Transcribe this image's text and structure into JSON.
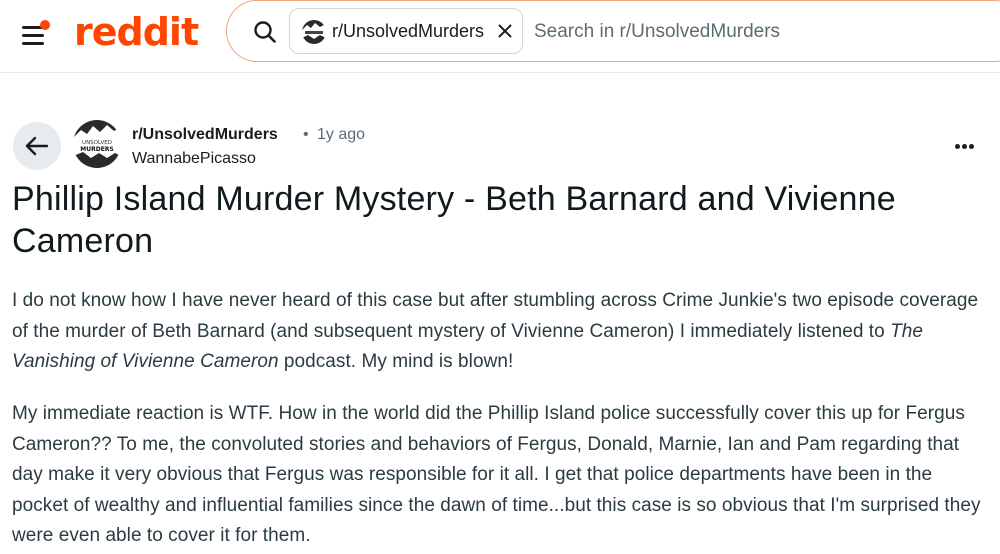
{
  "header": {
    "logo_text": "reddit",
    "brand_color": "#ff4500",
    "search": {
      "chip_label": "r/UnsolvedMurders",
      "placeholder": "Search in r/UnsolvedMurders",
      "value": ""
    }
  },
  "post": {
    "subreddit": "r/UnsolvedMurders",
    "subreddit_avatar_text": [
      "UNSOLVED",
      "MURDERS"
    ],
    "separator": "•",
    "time_ago": "1y ago",
    "author": "WannabePicasso",
    "title": "Phillip Island Murder Mystery - Beth Barnard and Vivienne Cameron",
    "body": {
      "p1_before": "I do not know how I have never heard of this case but after stumbling across Crime Junkie's two episode coverage of the murder of Beth Barnard (and subsequent mystery of Vivienne Cameron) I immediately listened to ",
      "p1_italic": "The Vanishing of Vivienne Cameron",
      "p1_after": " podcast. My mind is blown!",
      "p2": "My immediate reaction is WTF. How in the world did the Phillip Island police successfully cover this up for Fergus Cameron?? To me, the convoluted stories and behaviors of Fergus, Donald, Marnie, Ian and Pam regarding that day make it very obvious that Fergus was responsible for it all. I get that police departments have been in the pocket of wealthy and influential families since the dawn of time...but this case is so obvious that I'm surprised they were even able to cover it for them."
    }
  },
  "icons": {
    "menu": "hamburger-menu-icon",
    "search": "search-icon",
    "close": "close-icon",
    "back": "arrow-left-icon",
    "more": "more-options-icon"
  }
}
